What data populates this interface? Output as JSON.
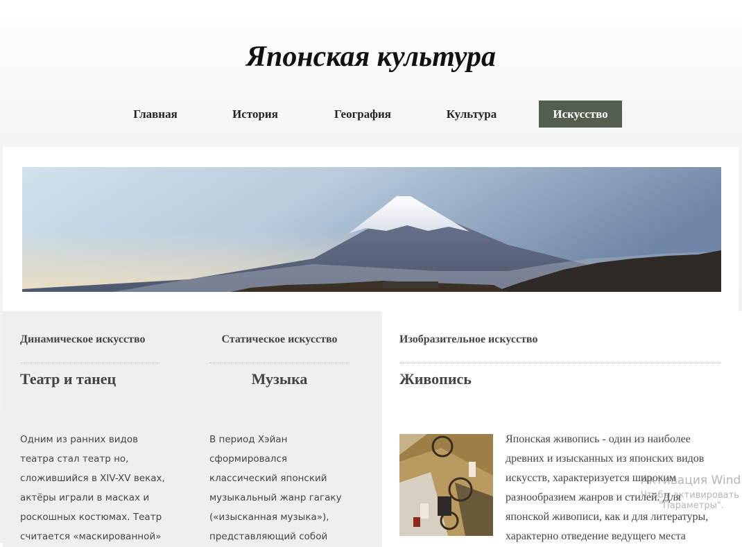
{
  "site": {
    "title": "Японская культура"
  },
  "nav": {
    "items": [
      {
        "label": "Главная"
      },
      {
        "label": "История"
      },
      {
        "label": "География"
      },
      {
        "label": "Культура"
      },
      {
        "label": "Искусство",
        "active": true
      }
    ]
  },
  "columns": [
    {
      "category": "Динамическое искусство",
      "heading": "Театр и танец",
      "lines": [
        "Одним из ранних видов",
        "театра стал театр но,",
        "сложившийся в XIV-XV веках,",
        "актёры играли в масках и",
        "роскошных костюмах. Театр",
        "считается «маскированной»"
      ]
    },
    {
      "category": "Статическое искусство",
      "heading": "Музыка",
      "lines": [
        "В период Хэйан",
        "сформировался",
        "классический японский",
        "музыкальный жанр гагаку",
        "(«изысканная музыка»),",
        "представляющий собой"
      ]
    },
    {
      "category": "Изобразительное искусство",
      "heading": "Живопись",
      "lines": [
        "Японская живопись - один из наиболее",
        "древних и изысканных из японских видов",
        "искусств, характеризуется широким",
        "разнообразием жанров и стилей. Для",
        "японской живописи, как и для литературы,",
        "характерно отведение ведущего места"
      ]
    }
  ],
  "watermark": {
    "line1": "Активация Wind",
    "line2": "Чтобы активировать",
    "line3": "\"Параметры\"."
  },
  "colors": {
    "nav_active_bg": "#545e4f",
    "nav_active_text": "#ffffff"
  },
  "icons": {
    "banner": "mount-fuji-photo",
    "painting": "genji-scroll-painting"
  }
}
